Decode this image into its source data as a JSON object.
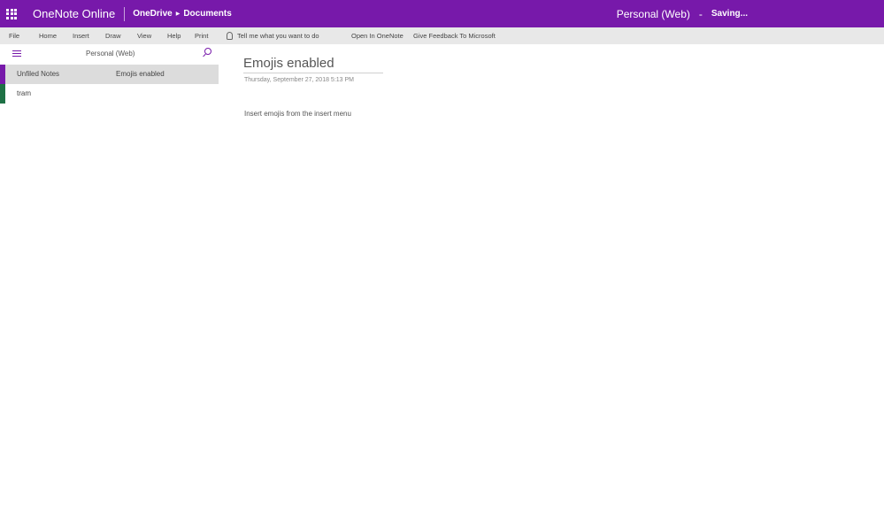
{
  "header": {
    "app_name": "OneNote Online",
    "breadcrumb": [
      "OneDrive",
      "Documents"
    ],
    "notebook_title": "Personal (Web)",
    "separator": "-",
    "status": "Saving..."
  },
  "menu": {
    "items": [
      "File",
      "Home",
      "Insert",
      "Draw",
      "View",
      "Help",
      "Print"
    ],
    "tell_me": "Tell me what you want to do",
    "open_in": "Open In OneNote",
    "feedback": "Give Feedback To Microsoft"
  },
  "nav": {
    "notebook_name": "Personal (Web)",
    "sections": [
      {
        "label": "Unfiled Notes",
        "color": "#7719aa"
      },
      {
        "label": "tram",
        "color": "#1e7145"
      }
    ],
    "pages": [
      {
        "label": "Emojis enabled"
      }
    ]
  },
  "page": {
    "title": "Emojis enabled",
    "date": "Thursday, September 27, 2018 5:13 PM",
    "body": "Insert emojis from the insert menu"
  },
  "colors": {
    "brand": "#7719aa",
    "menubar": "#e8e8e8",
    "selected": "#dcdcdc"
  }
}
